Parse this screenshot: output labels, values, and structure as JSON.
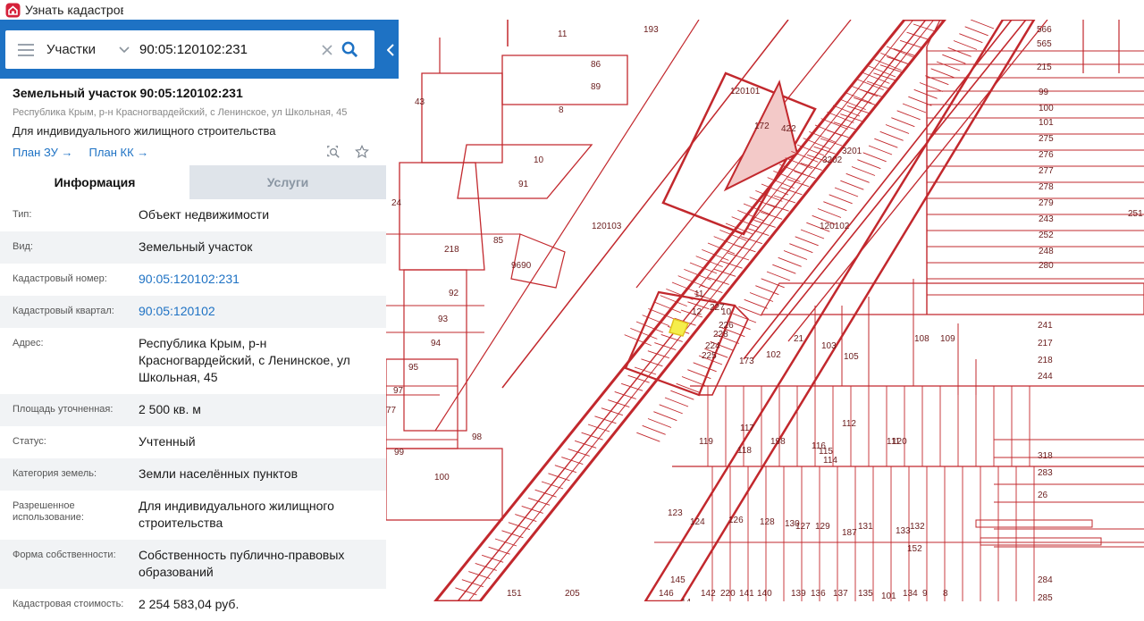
{
  "topbar": {
    "title": "Узнать кадастров",
    "home_icon": "home-icon"
  },
  "search": {
    "layer": "Участки",
    "query": "90:05:120102:231"
  },
  "parcel": {
    "title": "Земельный участок 90:05:120102:231",
    "address": "Республика Крым, р-н Красногвардейский, с Ленинское, ул Школьная, 45",
    "purpose": "Для индивидуального жилищного строительства",
    "links": [
      "План ЗУ",
      "План КК"
    ]
  },
  "tabs": [
    {
      "label": "Информация",
      "active": true
    },
    {
      "label": "Услуги",
      "active": false
    }
  ],
  "info": [
    {
      "label": "Тип:",
      "value": "Объект недвижимости"
    },
    {
      "label": "Вид:",
      "value": "Земельный участок"
    },
    {
      "label": "Кадастровый номер:",
      "value": "90:05:120102:231"
    },
    {
      "label": "Кадастровый квартал:",
      "value": "90:05:120102"
    },
    {
      "label": "Адрес:",
      "value": "Республика Крым, р-н Красногвардейский, с Ленинское, ул Школьная, 45"
    },
    {
      "label": "Площадь уточненная:",
      "value": "2 500 кв. м"
    },
    {
      "label": "Статус:",
      "value": "Учтенный"
    },
    {
      "label": "Категория земель:",
      "value": "Земли населённых пунктов"
    },
    {
      "label": "Разрешенное использование:",
      "value": "Для индивидуального жилищного строительства"
    },
    {
      "label": "Форма собственности:",
      "value": "Собственность публично-правовых образований"
    },
    {
      "label": "Кадастровая стоимость:",
      "value": "2 254 583,04 руб."
    }
  ],
  "map": {
    "colors": {
      "boundary": "#c2282d",
      "selected": "#f5ee4b",
      "building": "#f3c9c8"
    },
    "labels": [
      "11",
      "193",
      "566",
      "565",
      "215",
      "86",
      "89",
      "8",
      "43",
      "120101",
      "99",
      "100",
      "101",
      "275",
      "276",
      "277",
      "278",
      "279",
      "243",
      "252",
      "248",
      "280",
      "422",
      "3202",
      "3201",
      "172",
      "10",
      "91",
      "24",
      "120103",
      "120102",
      "251",
      "218",
      "85",
      "9690",
      "92",
      "93",
      "94",
      "95",
      "97",
      "77",
      "98",
      "99",
      "100",
      "241",
      "217",
      "218",
      "244",
      "318",
      "283",
      "26",
      "284",
      "285",
      "108",
      "109",
      "103",
      "21",
      "105",
      "102",
      "173",
      "119",
      "118",
      "117",
      "198",
      "116",
      "115",
      "114",
      "112",
      "111",
      "120",
      "123",
      "124",
      "126",
      "128",
      "127",
      "130",
      "129",
      "187",
      "131",
      "133",
      "132",
      "152",
      "151",
      "205",
      "146",
      "145",
      "14",
      "142",
      "220",
      "141",
      "140",
      "139",
      "136",
      "137",
      "135",
      "101",
      "134",
      "9",
      "8",
      "10",
      "12",
      "11",
      "227",
      "226",
      "228",
      "224",
      "225"
    ]
  }
}
